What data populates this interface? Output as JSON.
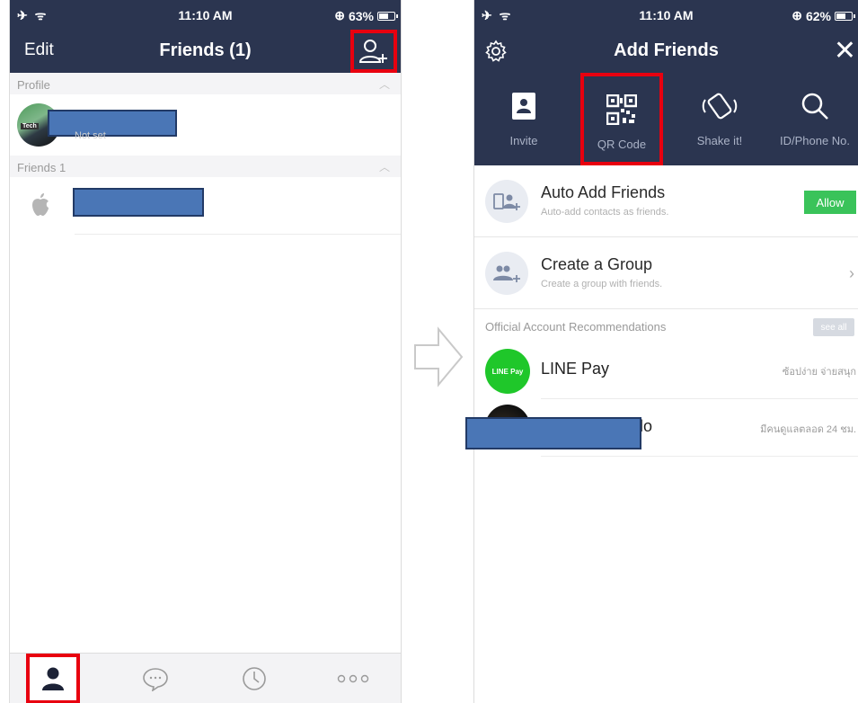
{
  "left_screen": {
    "status": {
      "time": "11:10 AM",
      "battery": "63%",
      "battery_level": 0.63
    },
    "nav": {
      "edit": "Edit",
      "title": "Friends (1)"
    },
    "profile_section": {
      "header": "Profile",
      "status_hint": "Not set"
    },
    "friends_section": {
      "header": "Friends 1"
    },
    "tabs": [
      "friends-icon",
      "chat-icon",
      "timeline-icon",
      "more-icon"
    ]
  },
  "right_screen": {
    "status": {
      "time": "11:10 AM",
      "battery": "62%",
      "battery_level": 0.62
    },
    "nav": {
      "title": "Add Friends"
    },
    "features": [
      {
        "label": "Invite",
        "icon": "invite-icon"
      },
      {
        "label": "QR Code",
        "icon": "qr-code-icon"
      },
      {
        "label": "Shake it!",
        "icon": "shake-icon"
      },
      {
        "label": "ID/Phone No.",
        "icon": "search-icon"
      }
    ],
    "options": [
      {
        "title": "Auto Add Friends",
        "subtitle": "Auto-add contacts as friends.",
        "action": "Allow"
      },
      {
        "title": "Create a Group",
        "subtitle": "Create a group with friends.",
        "action": "›"
      }
    ],
    "recommendations": {
      "header": "Official Account Recommendations",
      "see_all": "see all",
      "items": [
        {
          "name": "LINE Pay",
          "logo_text": "LINE Pay",
          "desc": "ซ้อปง่าย จ่ายสนุก"
        },
        {
          "name": "lo",
          "desc": "มีคนดูแลตลอด 24 ชม."
        }
      ]
    }
  },
  "colors": {
    "header_bg": "#2b3550",
    "highlight": "#e8000f",
    "allow": "#3ac35a",
    "redaction": "#4a76b6"
  }
}
